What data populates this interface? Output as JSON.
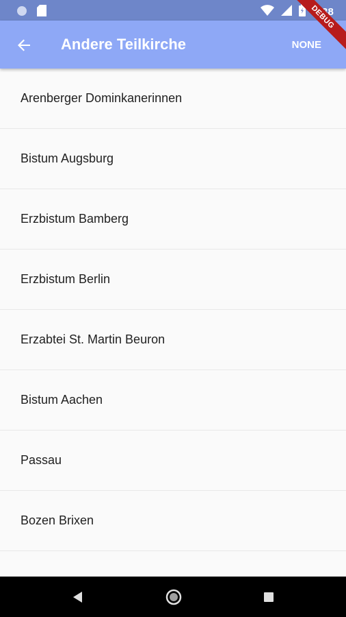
{
  "status_bar": {
    "time": "3:38",
    "icons": [
      "circle-icon",
      "sd-card-icon",
      "wifi-icon",
      "signal-icon",
      "battery-icon"
    ]
  },
  "app_bar": {
    "title": "Andere Teilkirche",
    "action_label": "NONE",
    "back_icon": "arrow-back-icon"
  },
  "debug_banner": {
    "label": "DEBUG"
  },
  "list": {
    "items": [
      {
        "label": "Arenberger Dominkanerinnen"
      },
      {
        "label": "Bistum Augsburg"
      },
      {
        "label": "Erzbistum Bamberg"
      },
      {
        "label": "Erzbistum Berlin"
      },
      {
        "label": "Erzabtei St. Martin Beuron"
      },
      {
        "label": "Bistum Aachen"
      },
      {
        "label": "Passau"
      },
      {
        "label": "Bozen Brixen"
      }
    ]
  },
  "nav_bar": {
    "icons": [
      "nav-back-icon",
      "nav-home-icon",
      "nav-recents-icon"
    ]
  },
  "colors": {
    "status_bar": "#6e86c9",
    "app_bar": "#8ea8f6",
    "background": "#fafafa",
    "debug": "#b71c1c"
  }
}
